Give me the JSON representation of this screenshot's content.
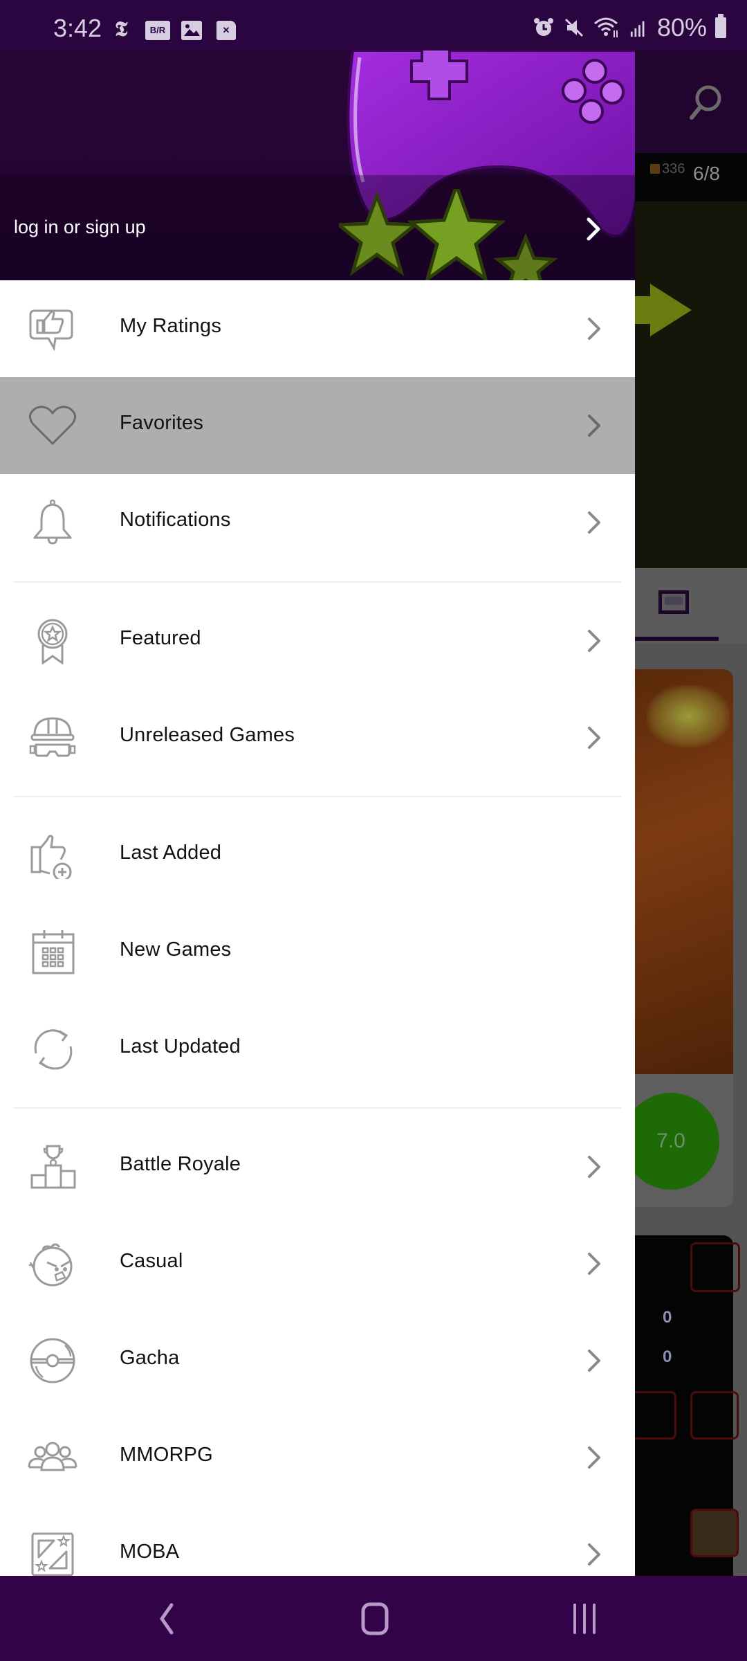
{
  "status_bar": {
    "time": "3:42",
    "left_icons": [
      "nyt-icon",
      "bleacher-report-icon",
      "image-icon",
      "close-notification-icon"
    ],
    "right_icons": [
      "alarm-icon",
      "mute-icon",
      "wifi-icon",
      "signal-icon"
    ],
    "battery_percent": "80%"
  },
  "drawer": {
    "header": {
      "login_label": "log in or sign up"
    },
    "sections": [
      {
        "items": [
          {
            "label": "My Ratings",
            "icon": "thumbs-up-speech-icon",
            "has_chevron": true,
            "active": false
          },
          {
            "label": "Favorites",
            "icon": "heart-icon",
            "has_chevron": true,
            "active": true
          },
          {
            "label": "Notifications",
            "icon": "bell-icon",
            "has_chevron": true,
            "active": false
          }
        ]
      },
      {
        "items": [
          {
            "label": "Featured",
            "icon": "award-badge-icon",
            "has_chevron": true,
            "active": false
          },
          {
            "label": "Unreleased Games",
            "icon": "hard-hat-icon",
            "has_chevron": true,
            "active": false
          }
        ]
      },
      {
        "items": [
          {
            "label": "Last Added",
            "icon": "thumbs-up-plus-icon",
            "has_chevron": false,
            "active": false
          },
          {
            "label": "New Games",
            "icon": "calendar-icon",
            "has_chevron": false,
            "active": false
          },
          {
            "label": "Last Updated",
            "icon": "refresh-icon",
            "has_chevron": false,
            "active": false
          }
        ]
      },
      {
        "items": [
          {
            "label": "Battle Royale",
            "icon": "trophy-podium-icon",
            "has_chevron": true,
            "active": false
          },
          {
            "label": "Casual",
            "icon": "angry-bird-icon",
            "has_chevron": true,
            "active": false
          },
          {
            "label": "Gacha",
            "icon": "pokeball-icon",
            "has_chevron": true,
            "active": false
          },
          {
            "label": "MMORPG",
            "icon": "group-icon",
            "has_chevron": true,
            "active": false
          },
          {
            "label": "MOBA",
            "icon": "moba-map-icon",
            "has_chevron": true,
            "active": false
          }
        ]
      }
    ]
  },
  "background_app": {
    "hud_coins": "336",
    "hud_level": "6/8",
    "score": "7.0"
  },
  "nav_bar": {
    "buttons": [
      "back",
      "home",
      "recents"
    ]
  },
  "colors": {
    "brand_purple": "#33034a",
    "active_row": "#aeaeae",
    "icon_gray": "#9a9a9a",
    "score_green": "#1d6a06"
  }
}
